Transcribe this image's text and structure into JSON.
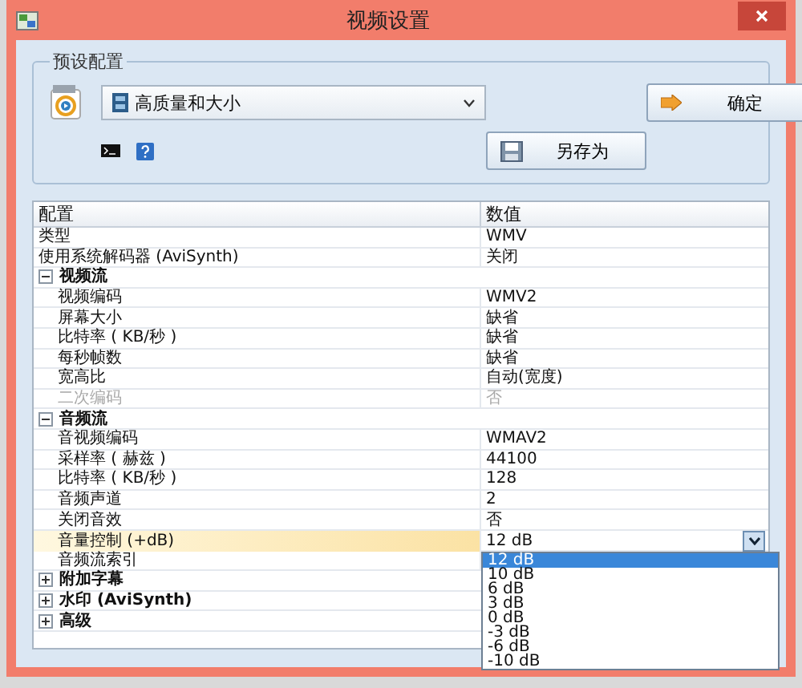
{
  "window": {
    "title": "视频设置"
  },
  "preset": {
    "legend": "预设配置",
    "profile": "高质量和大小",
    "confirm_button": "确定",
    "save_as_button": "另存为"
  },
  "grid": {
    "columns": [
      "配置",
      "数值"
    ],
    "items": [
      {
        "kind": "row",
        "label": "类型",
        "value": "WMV",
        "disabled": false,
        "selected": false
      },
      {
        "kind": "row",
        "label": "使用系统解码器 (AviSynth)",
        "value": "关闭",
        "disabled": false,
        "selected": false
      },
      {
        "kind": "group",
        "label": "视频流",
        "expanded": true,
        "children": [
          {
            "kind": "row",
            "label": "视频编码",
            "value": "WMV2",
            "disabled": false,
            "selected": false
          },
          {
            "kind": "row",
            "label": "屏幕大小",
            "value": "缺省",
            "disabled": false,
            "selected": false
          },
          {
            "kind": "row",
            "label": "比特率 ( KB/秒 )",
            "value": "缺省",
            "disabled": false,
            "selected": false
          },
          {
            "kind": "row",
            "label": "每秒帧数",
            "value": "缺省",
            "disabled": false,
            "selected": false
          },
          {
            "kind": "row",
            "label": "宽高比",
            "value": "自动(宽度)",
            "disabled": false,
            "selected": false
          },
          {
            "kind": "row",
            "label": "二次编码",
            "value": "否",
            "disabled": true,
            "selected": false
          }
        ]
      },
      {
        "kind": "group",
        "label": "音频流",
        "expanded": true,
        "children": [
          {
            "kind": "row",
            "label": "音视频编码",
            "value": "WMAV2",
            "disabled": false,
            "selected": false
          },
          {
            "kind": "row",
            "label": "采样率 ( 赫兹 )",
            "value": "44100",
            "disabled": false,
            "selected": false
          },
          {
            "kind": "row",
            "label": "比特率 ( KB/秒 )",
            "value": "128",
            "disabled": false,
            "selected": false
          },
          {
            "kind": "row",
            "label": "音频声道",
            "value": "2",
            "disabled": false,
            "selected": false
          },
          {
            "kind": "row",
            "label": "关闭音效",
            "value": "否",
            "disabled": false,
            "selected": false
          },
          {
            "kind": "row",
            "label": "音量控制 (+dB)",
            "value": "12 dB",
            "disabled": false,
            "selected": true
          },
          {
            "kind": "row",
            "label": "音频流索引",
            "disabled": false,
            "selected": false
          }
        ]
      },
      {
        "kind": "group",
        "label": "附加字幕",
        "expanded": false
      },
      {
        "kind": "group",
        "label": "水印 (AviSynth)",
        "expanded": false
      },
      {
        "kind": "group",
        "label": "高级",
        "expanded": false
      }
    ]
  },
  "dropdown": {
    "options": [
      {
        "label": "12 dB",
        "selected": true
      },
      {
        "label": "10 dB",
        "selected": false
      },
      {
        "label": "6 dB",
        "selected": false
      },
      {
        "label": "3 dB",
        "selected": false
      },
      {
        "label": "0 dB",
        "selected": false
      },
      {
        "label": "-3 dB",
        "selected": false
      },
      {
        "label": "-6 dB",
        "selected": false
      },
      {
        "label": "-10 dB",
        "selected": false
      }
    ]
  }
}
